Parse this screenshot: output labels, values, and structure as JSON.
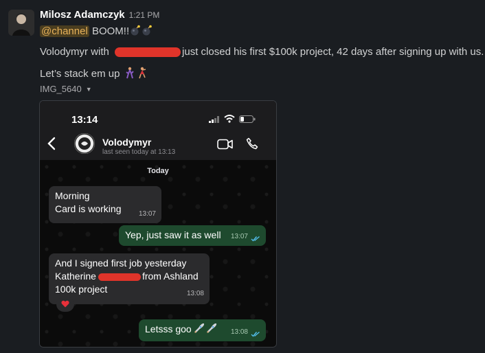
{
  "message": {
    "author": "Milosz Adamczyk",
    "time": "1:21 PM",
    "mention": "@channel",
    "boom_text": "BOOM!!",
    "line2_prefix": "Volodymyr with",
    "line2_suffix": "just closed his first $100k project, 42 days after signing up with us.",
    "line3": "Let’s stack em up",
    "file_name": "IMG_5640"
  },
  "phone": {
    "clock": "13:14",
    "contact_name": "Volodymyr",
    "last_seen": "last seen today at 13:13",
    "day_label": "Today",
    "messages": [
      {
        "direction": "in",
        "lines": [
          "Morning",
          "Card is working"
        ],
        "time": "13:07"
      },
      {
        "direction": "out",
        "text": "Yep, just saw it as well",
        "time": "13:07"
      },
      {
        "direction": "in",
        "line1": "And I signed first job yesterday",
        "line2_prefix": "Katherine",
        "line2_suffix": "from Ashland",
        "line3": "100k project",
        "time": "13:08",
        "reaction": "heart"
      },
      {
        "direction": "out",
        "text": "Letsss goo",
        "time": "13:08"
      }
    ]
  },
  "colors": {
    "background": "#1a1d21",
    "mention_text": "#e8b25a",
    "mention_bg": "#4a3d1f",
    "redaction": "#e0342a",
    "outgoing_bubble": "#1e4a2e",
    "incoming_bubble": "#2b2b2d",
    "read_ticks": "#53bdeb"
  },
  "icons": [
    "bomb-icon",
    "dancer-icon",
    "chevron-down-icon",
    "back-icon",
    "video-call-icon",
    "phone-call-icon",
    "signal-icon",
    "wifi-icon",
    "battery-icon",
    "double-check-icon",
    "heart-icon",
    "rocket-icon"
  ]
}
